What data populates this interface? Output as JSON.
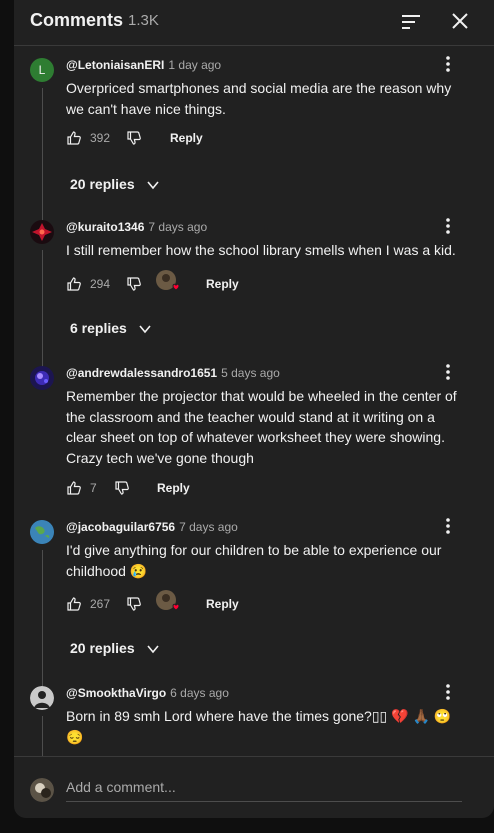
{
  "header": {
    "title": "Comments",
    "count": "1.3K",
    "sort_icon": "sort-icon",
    "close_icon": "close-icon"
  },
  "comments": [
    {
      "initial": "L",
      "handle": "@LetoniaisanERI",
      "time": "1 day ago",
      "text": "Overpriced smartphones and social media are the reason why we can't have nice things.",
      "likes": "392",
      "reply_label": "Reply",
      "replies_label": "20 replies"
    },
    {
      "handle": "@kuraito1346",
      "time": "7 days ago",
      "text": "I still remember how the school library smells when I was a kid.",
      "likes": "294",
      "reply_label": "Reply",
      "replies_label": "6 replies"
    },
    {
      "handle": "@andrewdalessandro1651",
      "time": "5 days ago",
      "text": "Remember the projector that would be wheeled in the center of the classroom and the teacher would stand at it writing on a clear sheet on top of whatever worksheet they were showing. Crazy tech we've gone though",
      "likes": "7",
      "reply_label": "Reply"
    },
    {
      "handle": "@jacobaguilar6756",
      "time": "7 days ago",
      "text": "I'd give anything for our children to be able to experience our childhood 😢",
      "likes": "267",
      "reply_label": "Reply",
      "replies_label": "20 replies"
    },
    {
      "handle": "@SmookthaVirgo",
      "time": "6 days ago",
      "text": "Born in 89 smh Lord where have the times gone?▯▯ 💔 🙏🏾 🙄 😔"
    }
  ],
  "footer": {
    "placeholder": "Add a comment..."
  },
  "colors": {
    "background": "#212121",
    "text": "#f1f1f1",
    "secondary": "#aaaaaa",
    "heart": "#ff0033",
    "avatar_green": "#2e7d32"
  }
}
